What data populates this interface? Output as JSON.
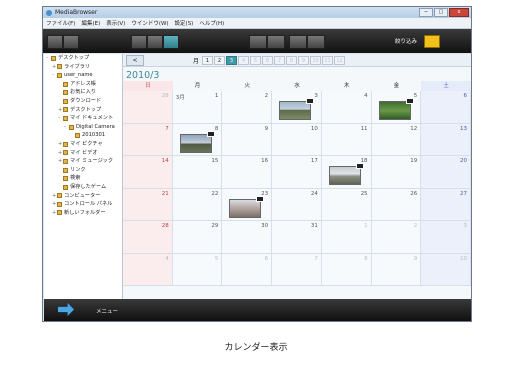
{
  "window": {
    "title": "MediaBrowser",
    "buttons": {
      "minimize": "─",
      "maximize": "□",
      "close": "x"
    }
  },
  "menu": [
    "ファイル(F)",
    "編集(E)",
    "表示(V)",
    "ウインドウ(W)",
    "設定(S)",
    "ヘルプ(H)"
  ],
  "toolbar": {
    "filter_label": "絞り込み"
  },
  "sidebar": {
    "items": [
      {
        "label": "デスクトップ",
        "indent": 0,
        "toggle": "-"
      },
      {
        "label": "ライブラリ",
        "indent": 1,
        "toggle": "+"
      },
      {
        "label": "user_name",
        "indent": 1,
        "toggle": "-"
      },
      {
        "label": "アドレス帳",
        "indent": 2,
        "toggle": ""
      },
      {
        "label": "お気に入り",
        "indent": 2,
        "toggle": ""
      },
      {
        "label": "ダウンロード",
        "indent": 2,
        "toggle": ""
      },
      {
        "label": "デスクトップ",
        "indent": 2,
        "toggle": "+"
      },
      {
        "label": "マイ ドキュメント",
        "indent": 2,
        "toggle": "-"
      },
      {
        "label": "Digital Camera",
        "indent": 3,
        "toggle": "-"
      },
      {
        "label": "2010301",
        "indent": 4,
        "toggle": ""
      },
      {
        "label": "マイ ピクチャ",
        "indent": 2,
        "toggle": "+"
      },
      {
        "label": "マイ ビデオ",
        "indent": 2,
        "toggle": "+"
      },
      {
        "label": "マイ ミュージック",
        "indent": 2,
        "toggle": "+"
      },
      {
        "label": "リンク",
        "indent": 2,
        "toggle": ""
      },
      {
        "label": "検索",
        "indent": 2,
        "toggle": ""
      },
      {
        "label": "保存したゲーム",
        "indent": 2,
        "toggle": ""
      },
      {
        "label": "コンピューター",
        "indent": 1,
        "toggle": "+"
      },
      {
        "label": "コントロール パネル",
        "indent": 1,
        "toggle": "+"
      },
      {
        "label": "新しいフォルダー",
        "indent": 1,
        "toggle": "+"
      }
    ]
  },
  "calendar": {
    "nav_prev": "<",
    "month_label": "月",
    "month_tabs": [
      "1",
      "2",
      "3",
      "4",
      "5",
      "6",
      "7",
      "8",
      "9",
      "10",
      "11",
      "12"
    ],
    "active_month": 3,
    "title": "2010/3",
    "weekdays": [
      "日",
      "月",
      "火",
      "水",
      "木",
      "金",
      "土"
    ],
    "weeks": [
      [
        {
          "d": "28",
          "o": true
        },
        {
          "d": "1",
          "m": "3月"
        },
        {
          "d": "2"
        },
        {
          "d": "3",
          "t": "a"
        },
        {
          "d": "4"
        },
        {
          "d": "5",
          "t": "b"
        },
        {
          "d": "6"
        }
      ],
      [
        {
          "d": "7"
        },
        {
          "d": "8",
          "t": "c"
        },
        {
          "d": "9"
        },
        {
          "d": "10"
        },
        {
          "d": "11"
        },
        {
          "d": "12"
        },
        {
          "d": "13"
        }
      ],
      [
        {
          "d": "14"
        },
        {
          "d": "15"
        },
        {
          "d": "16"
        },
        {
          "d": "17"
        },
        {
          "d": "18",
          "t": "d"
        },
        {
          "d": "19"
        },
        {
          "d": "20"
        }
      ],
      [
        {
          "d": "21"
        },
        {
          "d": "22"
        },
        {
          "d": "23",
          "t": "e"
        },
        {
          "d": "24"
        },
        {
          "d": "25"
        },
        {
          "d": "26"
        },
        {
          "d": "27"
        }
      ],
      [
        {
          "d": "28"
        },
        {
          "d": "29"
        },
        {
          "d": "30"
        },
        {
          "d": "31"
        },
        {
          "d": "1",
          "o": true
        },
        {
          "d": "2",
          "o": true
        },
        {
          "d": "3",
          "o": true
        }
      ],
      [
        {
          "d": "4",
          "o": true
        },
        {
          "d": "5",
          "o": true
        },
        {
          "d": "6",
          "o": true
        },
        {
          "d": "7",
          "o": true
        },
        {
          "d": "8",
          "o": true
        },
        {
          "d": "9",
          "o": true
        },
        {
          "d": "10",
          "o": true
        }
      ]
    ]
  },
  "bottombar": {
    "menu_label": "メニュー"
  },
  "caption": "カレンダー表示"
}
